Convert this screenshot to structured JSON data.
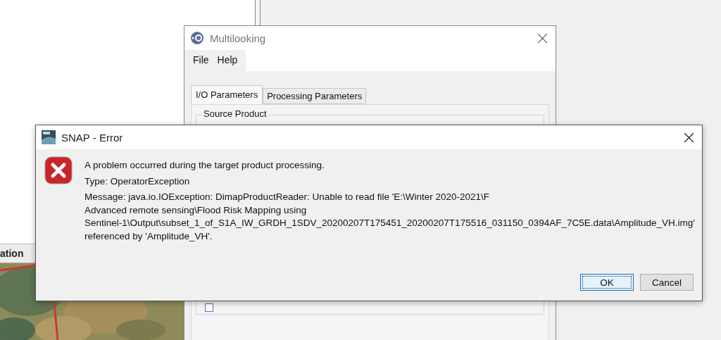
{
  "background_panel": {
    "header": "ation"
  },
  "multilooking": {
    "title": "Multilooking",
    "menu": [
      "File",
      "Help"
    ],
    "tabs": [
      {
        "label": "I/O Parameters",
        "selected": true
      },
      {
        "label": "Processing Parameters",
        "selected": false
      }
    ],
    "group_title": "Source Product",
    "checkbox": {
      "checked": false
    }
  },
  "error_dialog": {
    "title": "SNAP - Error",
    "lines": [
      "A problem occurred during the target product processing.",
      "Type: OperatorException",
      "Message: java.io.IOException: DimapProductReader: Unable to read file 'E:\\Winter 2020-2021\\F",
      "Advanced remote sensing\\Flood Risk Mapping using",
      "Sentinel-1\\Output\\subset_1_of_S1A_IW_GRDH_1SDV_20200207T175451_20200207T175516_031150_0394AF_7C5E.data\\Amplitude_VH.img'",
      "referenced by 'Amplitude_VH'."
    ],
    "buttons": [
      {
        "label": "OK",
        "default": true
      },
      {
        "label": "Cancel",
        "default": false
      }
    ]
  }
}
